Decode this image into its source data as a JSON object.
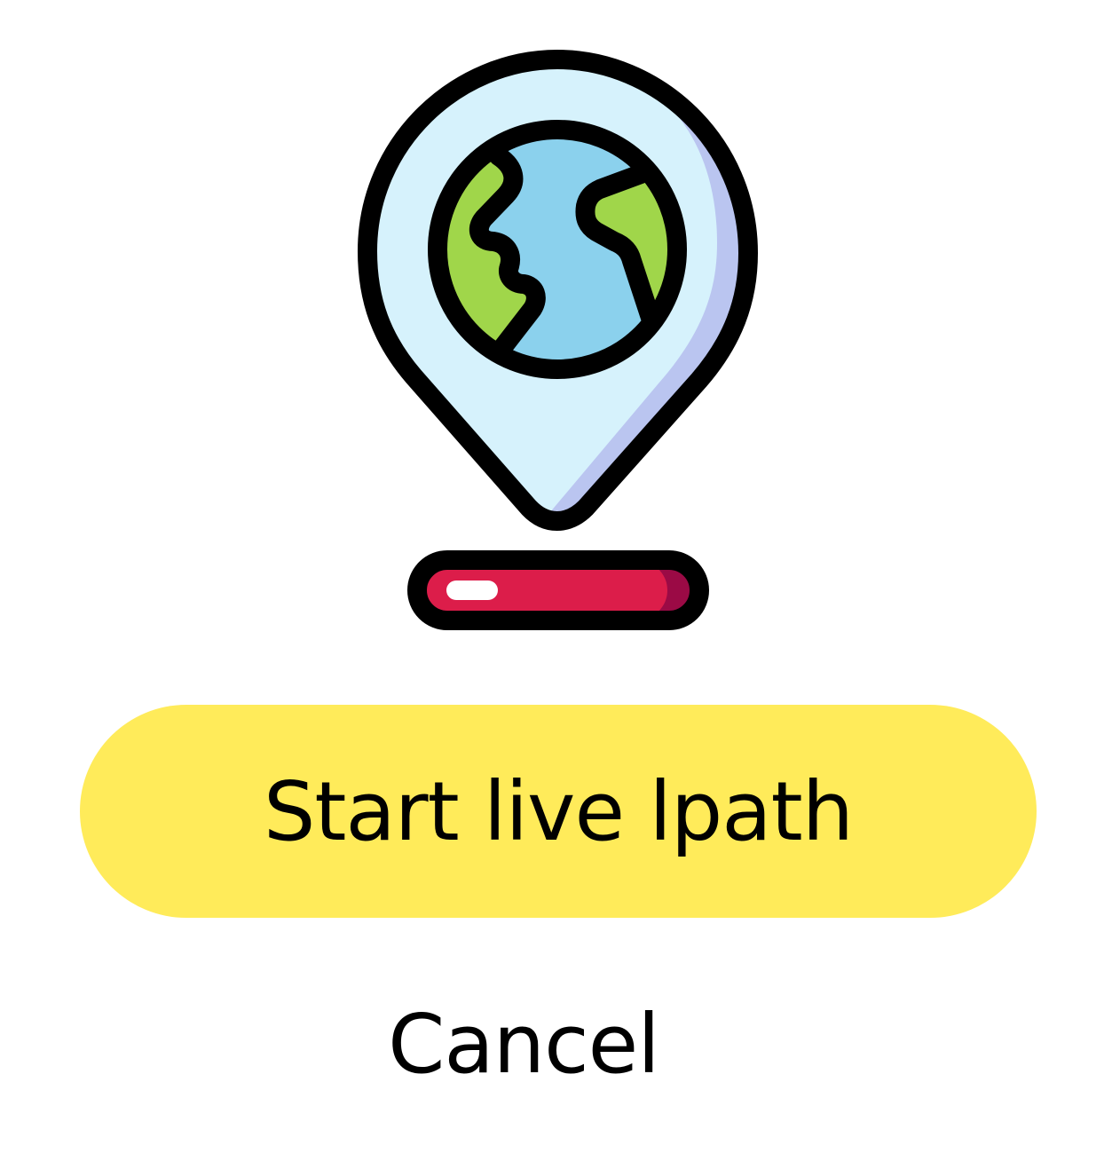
{
  "illustration": {
    "icon": "globe-location-pin-icon",
    "colors": {
      "pin_fill": "#D6F2FC",
      "pin_shade": "#BAC5F0",
      "globe_ocean": "#8BD1ED",
      "globe_land": "#A0D64A",
      "base_red": "#DC1D4A",
      "base_dark": "#9B0A45",
      "outline": "#000000"
    }
  },
  "actions": {
    "start_label": "Start live lpath",
    "cancel_label": "Cancel"
  },
  "colors": {
    "primary_button": "#FFEB5A",
    "text": "#000000",
    "background": "#FFFFFF"
  }
}
